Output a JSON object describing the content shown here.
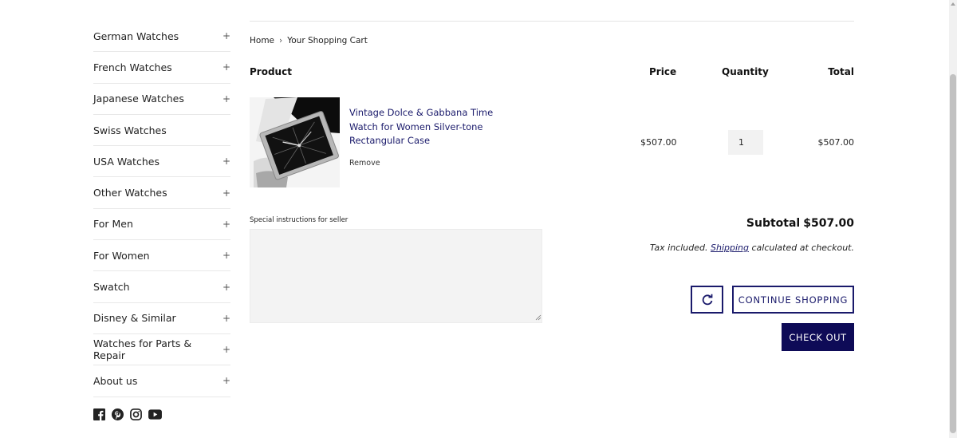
{
  "sidebar": {
    "items": [
      {
        "label": "German Watches",
        "expand": "+"
      },
      {
        "label": "French Watches",
        "expand": "+"
      },
      {
        "label": "Japanese Watches",
        "expand": "+"
      },
      {
        "label": "Swiss Watches",
        "expand": ""
      },
      {
        "label": "USA Watches",
        "expand": "+"
      },
      {
        "label": "Other Watches",
        "expand": "+"
      },
      {
        "label": "For Men",
        "expand": "+"
      },
      {
        "label": "For Women",
        "expand": "+"
      },
      {
        "label": "Swatch",
        "expand": "+"
      },
      {
        "label": "Disney & Similar",
        "expand": "+"
      },
      {
        "label": "Watches for Parts & Repair",
        "expand": "+"
      },
      {
        "label": "About us",
        "expand": "+"
      }
    ],
    "socials": [
      "facebook-icon",
      "pinterest-icon",
      "instagram-icon",
      "youtube-icon"
    ]
  },
  "breadcrumb": {
    "home": "Home",
    "separator": "›",
    "current": "Your Shopping Cart"
  },
  "cart": {
    "headers": {
      "product": "Product",
      "price": "Price",
      "quantity": "Quantity",
      "total": "Total"
    },
    "item": {
      "title": "Vintage Dolce & Gabbana Time Watch for Women Silver-tone Rectangular Case",
      "remove": "Remove",
      "price": "$507.00",
      "quantity": "1",
      "total": "$507.00"
    },
    "instructions_label": "Special instructions for seller",
    "instructions_value": "",
    "subtotal_label": "Subtotal",
    "subtotal_value": "$507.00",
    "tax_prefix": "Tax included.",
    "tax_link": "Shipping",
    "tax_suffix": "calculated at checkout.",
    "continue_label": "CONTINUE SHOPPING",
    "checkout_label": "CHECK OUT"
  },
  "colors": {
    "accent": "#0e0b57",
    "link": "#1a1a6b",
    "field_bg": "#f3f3f3"
  }
}
